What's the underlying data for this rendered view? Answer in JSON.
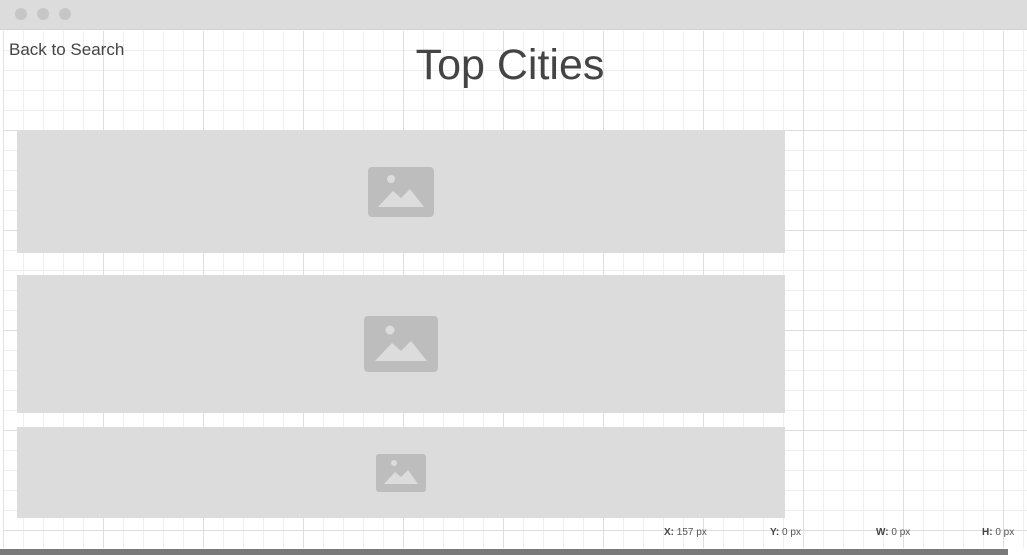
{
  "window": {
    "traffic_lights": [
      "close",
      "minimize",
      "zoom"
    ]
  },
  "header": {
    "back_label": "Back to Search",
    "title": "Top Cities"
  },
  "cards": [
    {
      "icon": "image-placeholder-icon"
    },
    {
      "icon": "image-placeholder-icon"
    },
    {
      "icon": "image-placeholder-icon"
    }
  ],
  "status": {
    "x_label": "X:",
    "x_value": "157 px",
    "y_label": "Y:",
    "y_value": "0 px",
    "w_label": "W:",
    "w_value": "0 px",
    "h_label": "H:",
    "h_value": "0 px"
  },
  "colors": {
    "placeholder_bg": "#dcdcdc",
    "placeholder_icon": "#bdbdbd",
    "text": "#444444"
  }
}
